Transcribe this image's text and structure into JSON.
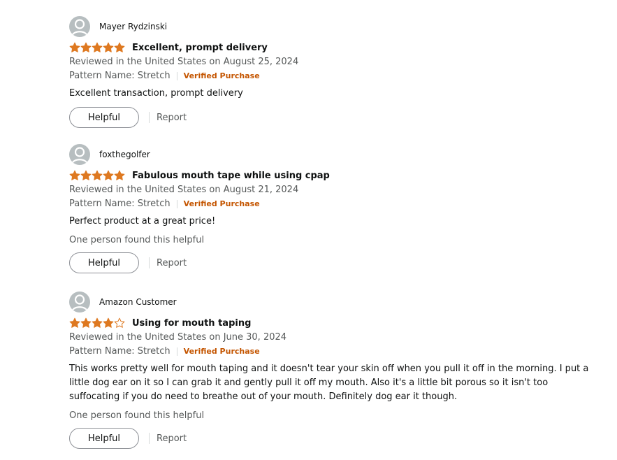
{
  "colors": {
    "star": "#de7921",
    "verified": "#c45500",
    "muted": "#565959"
  },
  "reviews": [
    {
      "username": "Mayer Rydzinski",
      "rating": 5,
      "title": "Excellent, prompt delivery",
      "date": "Reviewed in the United States on August 25, 2024",
      "pattern": "Pattern Name: Stretch",
      "verified": "Verified Purchase",
      "body": "Excellent transaction, prompt delivery",
      "helpful_count": "",
      "helpful_label": "Helpful",
      "report_label": "Report"
    },
    {
      "username": "foxthegolfer",
      "rating": 5,
      "title": "Fabulous mouth tape while using cpap",
      "date": "Reviewed in the United States on August 21, 2024",
      "pattern": "Pattern Name: Stretch",
      "verified": "Verified Purchase",
      "body": "Perfect product at a great price!",
      "helpful_count": "One person found this helpful",
      "helpful_label": "Helpful",
      "report_label": "Report"
    },
    {
      "username": "Amazon Customer",
      "rating": 4,
      "title": "Using for mouth taping",
      "date": "Reviewed in the United States on June 30, 2024",
      "pattern": "Pattern Name: Stretch",
      "verified": "Verified Purchase",
      "body": "This works pretty well for mouth taping and it doesn't tear your skin off when you pull it off in the morning. I put a little dog ear on it so I can grab it and gently pull it off my mouth. Also it's a little bit porous so it isn't too suffocating if you do need to breathe out of your mouth. Definitely dog ear it though.",
      "helpful_count": "One person found this helpful",
      "helpful_label": "Helpful",
      "report_label": "Report"
    }
  ]
}
